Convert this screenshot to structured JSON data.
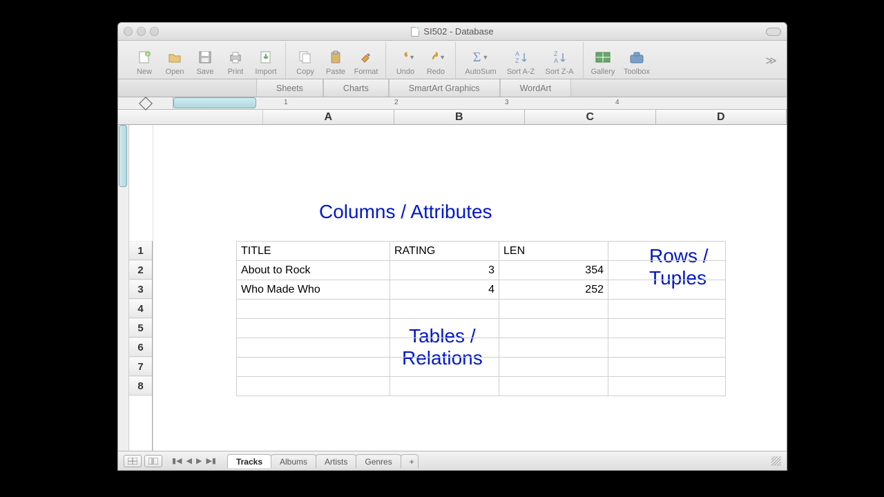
{
  "window": {
    "title": "SI502 - Database"
  },
  "toolbar": {
    "new": "New",
    "open": "Open",
    "save": "Save",
    "print": "Print",
    "import": "Import",
    "copy": "Copy",
    "paste": "Paste",
    "format": "Format",
    "undo": "Undo",
    "redo": "Redo",
    "autosum": "AutoSum",
    "sortaz": "Sort A-Z",
    "sortza": "Sort Z-A",
    "gallery": "Gallery",
    "toolbox": "Toolbox"
  },
  "tabs": {
    "sheets": "Sheets",
    "charts": "Charts",
    "smartart": "SmartArt Graphics",
    "wordart": "WordArt"
  },
  "columns": [
    "A",
    "B",
    "C",
    "D"
  ],
  "rows": [
    "1",
    "2",
    "3",
    "4",
    "5",
    "6",
    "7",
    "8"
  ],
  "annotations": {
    "columns": "Columns / Attributes",
    "rows": "Rows /\nTuples",
    "tables": "Tables /\nRelations"
  },
  "table": {
    "headers": {
      "title": "TITLE",
      "rating": "RATING",
      "len": "LEN"
    },
    "rows": [
      {
        "title": "About to Rock",
        "rating": "3",
        "len": "354"
      },
      {
        "title": "Who Made Who",
        "rating": "4",
        "len": "252"
      }
    ]
  },
  "sheets": {
    "tracks": "Tracks",
    "albums": "Albums",
    "artists": "Artists",
    "genres": "Genres"
  },
  "ruler_marks": [
    "1",
    "2",
    "3",
    "4"
  ]
}
